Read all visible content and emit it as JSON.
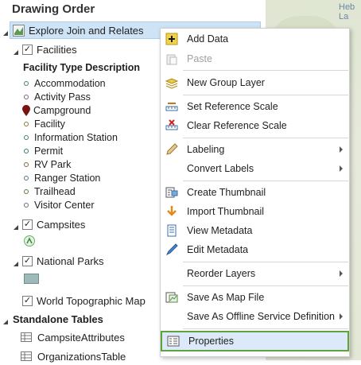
{
  "pane": {
    "title": "Drawing Order",
    "map_label": "Heb\nLa",
    "selected_layer": "Explore Join and Relates",
    "facilities_layer": "Facilities",
    "legend_heading": "Facility Type Description",
    "legend_items": [
      "Accommodation",
      "Activity Pass",
      "Campground",
      "Facility",
      "Information Station",
      "Permit",
      "RV Park",
      "Ranger Station",
      "Trailhead",
      "Visitor Center"
    ],
    "campsites_layer": "Campsites",
    "national_parks_layer": "National Parks",
    "basemap_layer": "World Topographic Map",
    "standalone_heading": "Standalone Tables",
    "tables": [
      "CampsiteAttributes",
      "OrganizationsTable"
    ]
  },
  "menu": {
    "items": [
      {
        "label": "Add Data",
        "icon": "add-data-icon",
        "enabled": true,
        "submenu": false
      },
      {
        "label": "Paste",
        "icon": "paste-icon",
        "enabled": false,
        "submenu": false
      },
      {
        "label": "New Group Layer",
        "icon": "group-layer-icon",
        "enabled": true,
        "submenu": false
      },
      {
        "label": "Set Reference Scale",
        "icon": "set-scale-icon",
        "enabled": true,
        "submenu": false
      },
      {
        "label": "Clear Reference Scale",
        "icon": "clear-scale-icon",
        "enabled": true,
        "submenu": false
      },
      {
        "label": "Labeling",
        "icon": "labeling-icon",
        "enabled": true,
        "submenu": true
      },
      {
        "label": "Convert Labels",
        "icon": "",
        "enabled": true,
        "submenu": true
      },
      {
        "label": "Create Thumbnail",
        "icon": "thumbnail-icon",
        "enabled": true,
        "submenu": false
      },
      {
        "label": "Import Thumbnail",
        "icon": "import-icon",
        "enabled": true,
        "submenu": false
      },
      {
        "label": "View Metadata",
        "icon": "view-metadata-icon",
        "enabled": true,
        "submenu": false
      },
      {
        "label": "Edit Metadata",
        "icon": "edit-metadata-icon",
        "enabled": true,
        "submenu": false
      },
      {
        "label": "Reorder Layers",
        "icon": "",
        "enabled": true,
        "submenu": true
      },
      {
        "label": "Save As Map File",
        "icon": "save-map-file-icon",
        "enabled": true,
        "submenu": false
      },
      {
        "label": "Save As Offline Service Definition",
        "icon": "",
        "enabled": true,
        "submenu": true
      },
      {
        "label": "Properties",
        "icon": "properties-icon",
        "enabled": true,
        "submenu": false
      }
    ]
  },
  "colors": {
    "selection": "#cfe3f7",
    "highlight_border": "#5ea33b",
    "campground_marker": "#7a1414"
  }
}
